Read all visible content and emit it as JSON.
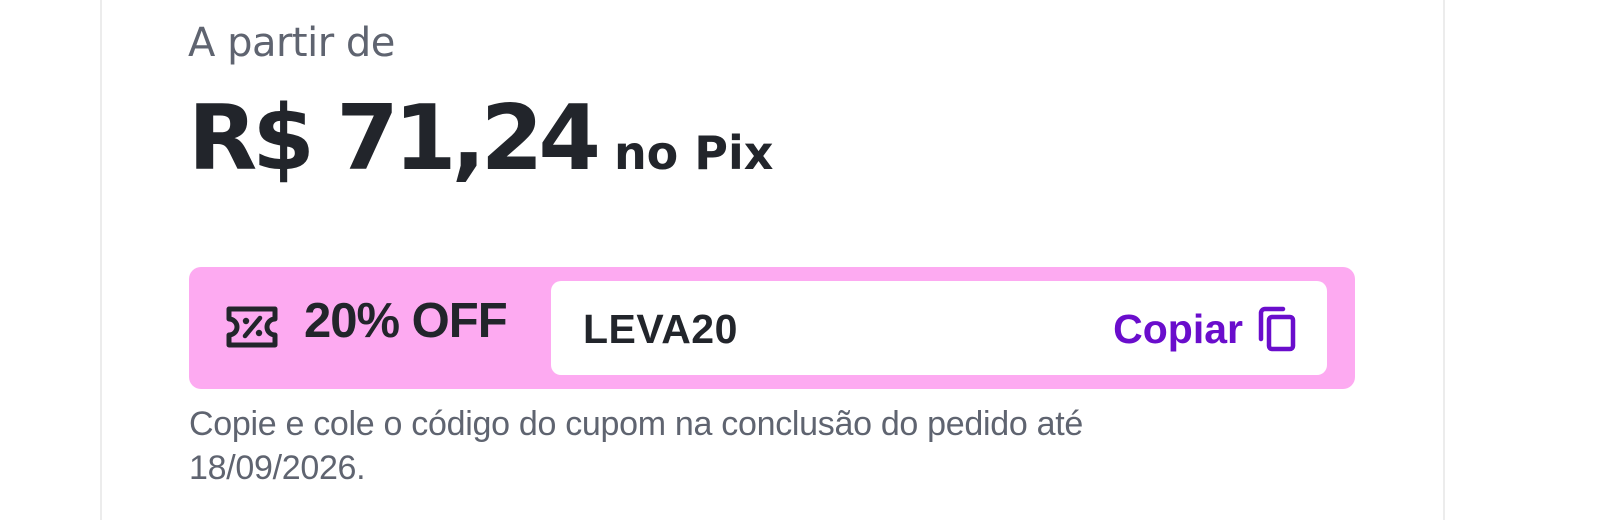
{
  "offer": {
    "from_label": "A partir de",
    "price": "R$ 71,24",
    "payment_suffix": "no Pix"
  },
  "coupon": {
    "icon": "ticket-percent-icon",
    "discount_label": "20% OFF",
    "code": "LEVA20",
    "copy_label": "Copiar",
    "copy_icon": "copy-icon",
    "background_color": "#fdaaf1",
    "accent_color": "#6a0dcc"
  },
  "note": {
    "text": "Copie e cole o código do cupom na conclusão do pedido até 18/09/2026."
  }
}
